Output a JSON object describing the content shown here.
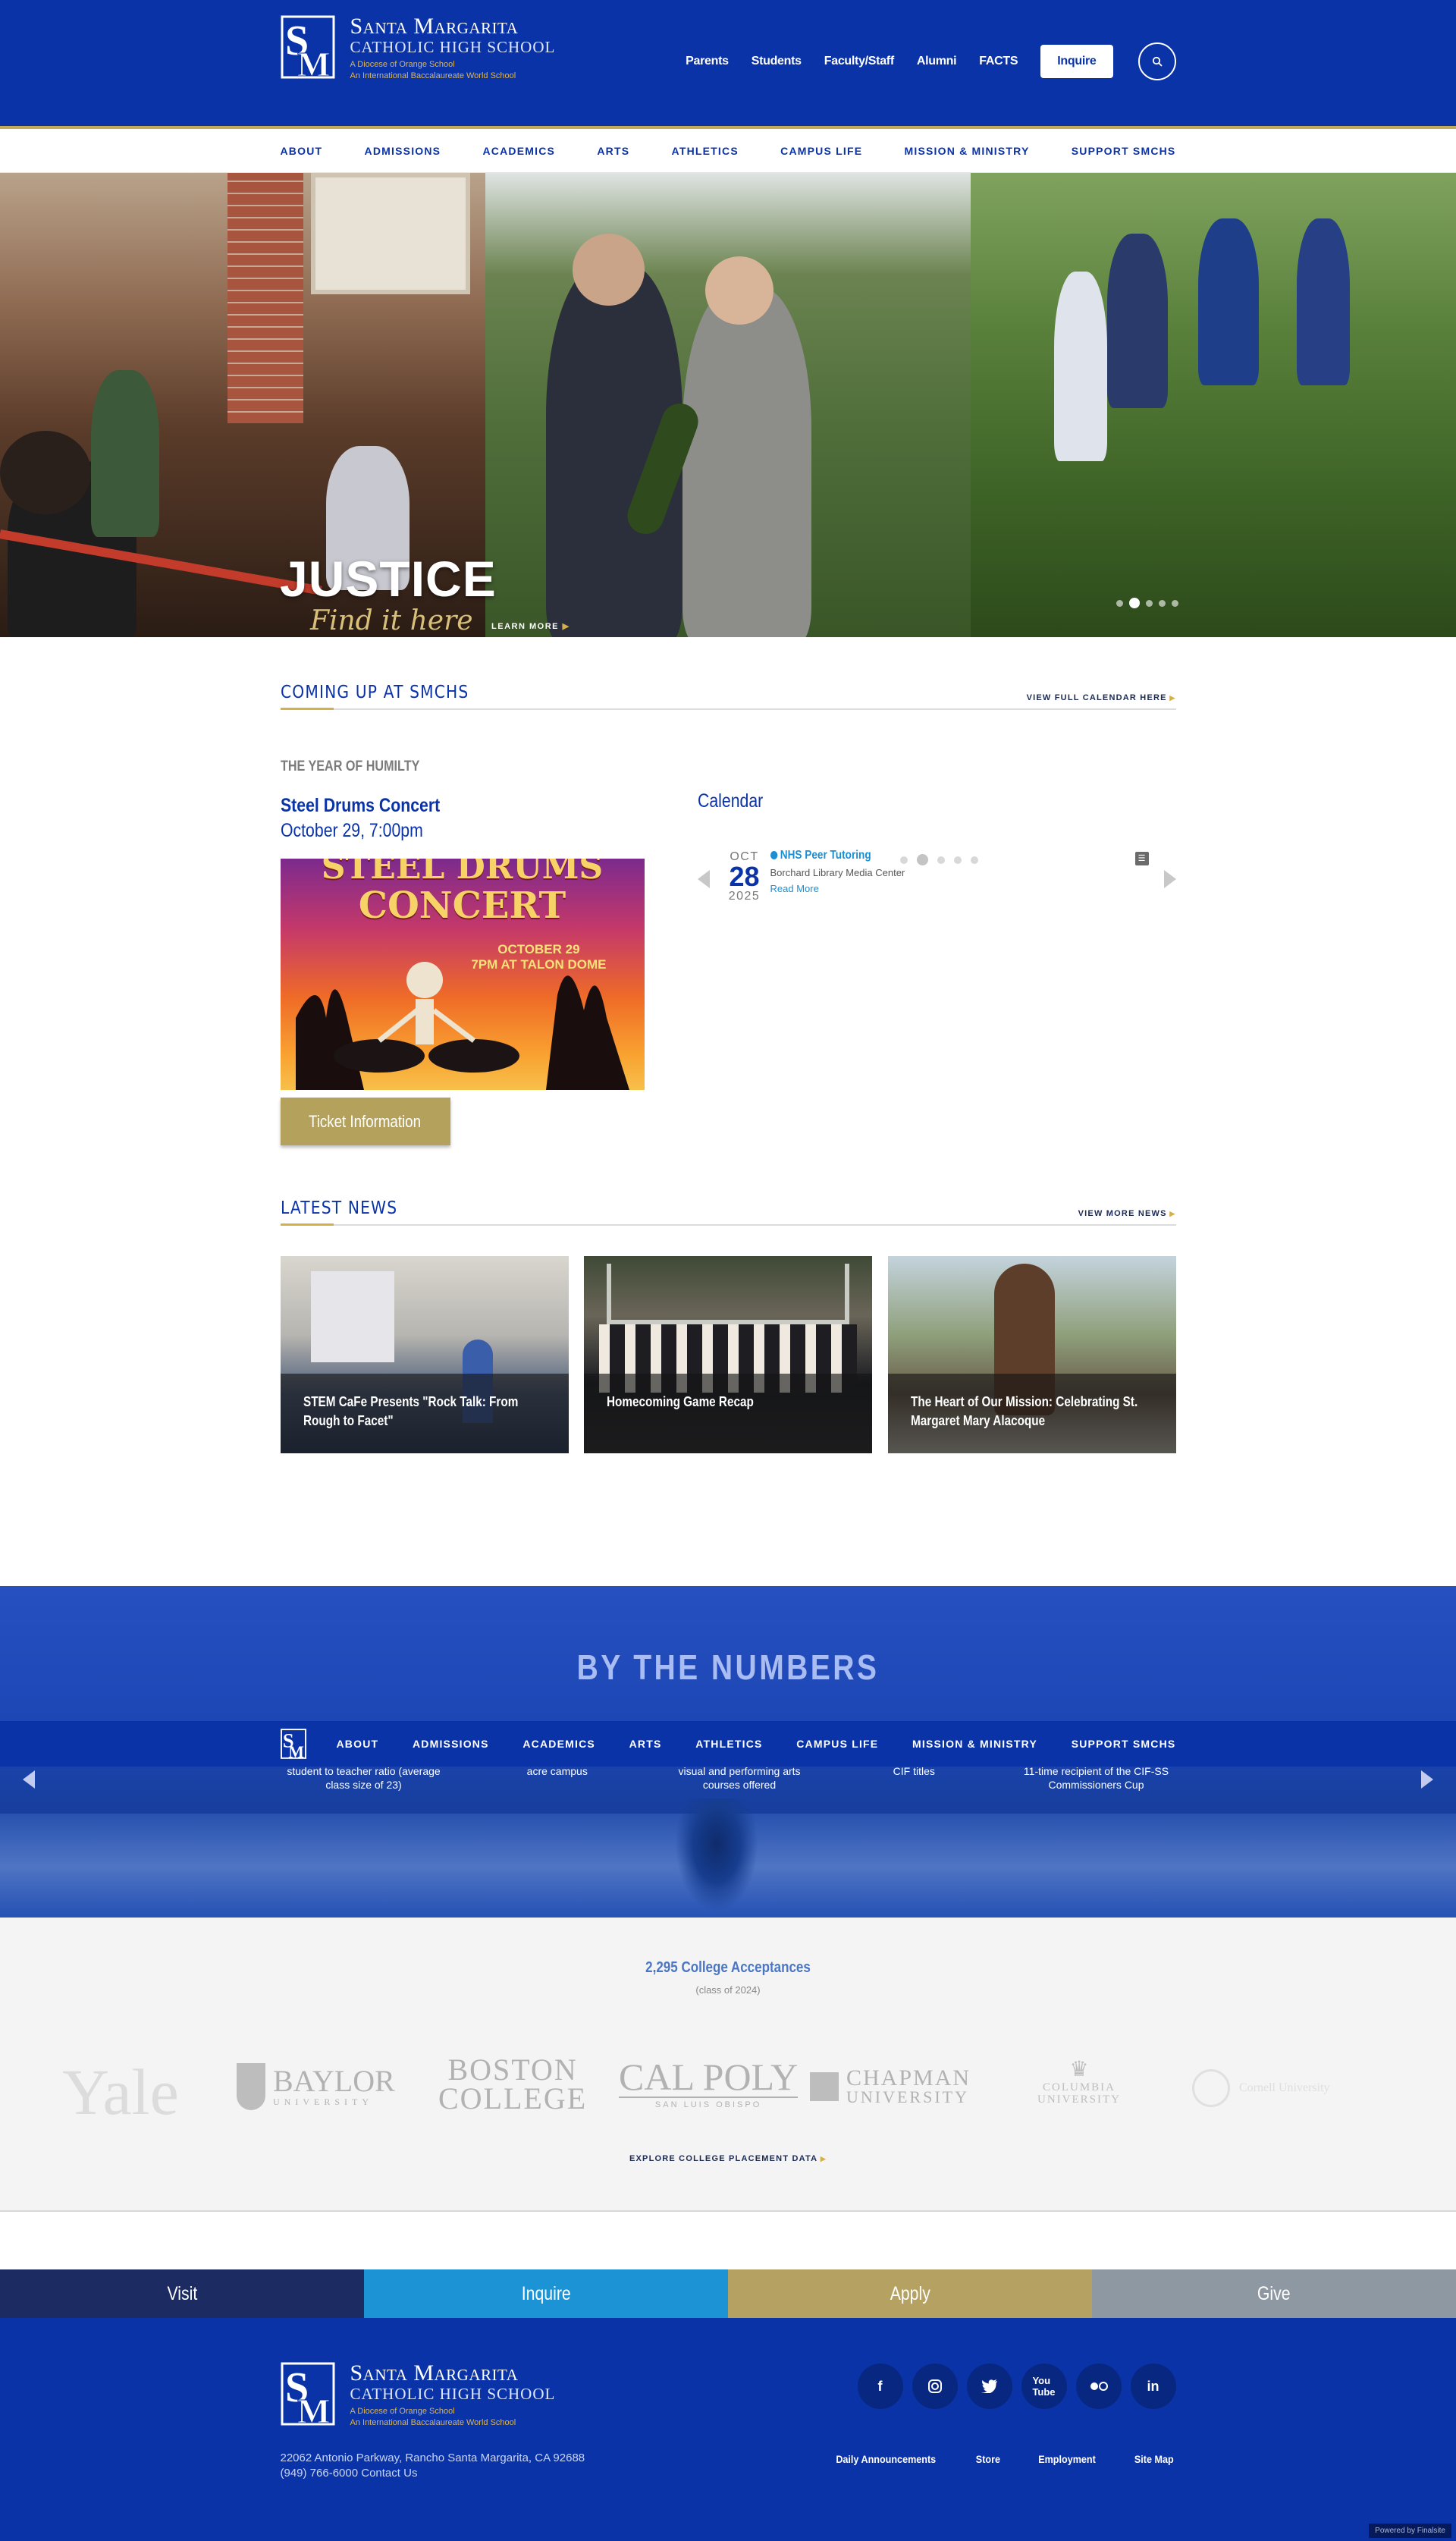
{
  "header": {
    "logo": {
      "name": "Santa Margarita",
      "sub": "Catholic High School",
      "tag1": "A Diocese of Orange School",
      "tag2": "An International Baccalaureate World School"
    },
    "utility": [
      "Parents",
      "Students",
      "Faculty/Staff",
      "Alumni",
      "FACTS"
    ],
    "inquire": "Inquire",
    "search_icon": "search-icon"
  },
  "nav": [
    "ABOUT",
    "ADMISSIONS",
    "ACADEMICS",
    "ARTS",
    "ATHLETICS",
    "CAMPUS LIFE",
    "MISSION & MINISTRY",
    "SUPPORT SMCHS"
  ],
  "hero": {
    "title": "JUSTICE",
    "script": "Find it here",
    "learn_more": "LEARN MORE",
    "active_slide": 2,
    "slide_count": 5
  },
  "coming": {
    "title": "COMING UP AT SMCHS",
    "link": "VIEW FULL CALENDAR HERE",
    "eyebrow": "THE YEAR OF HUMILTY",
    "event_title": "Steel Drums Concert",
    "event_date": "October 29, 7:00pm",
    "poster": {
      "line1": "STEEL DRUMS",
      "line2": "CONCERT",
      "date_line1": "OCTOBER 29",
      "date_line2": "7PM AT TALON DOME"
    },
    "ticket": "Ticket Information",
    "calendar": {
      "title": "Calendar",
      "month": "OCT",
      "day": "28",
      "year": "2025",
      "event": "NHS Peer Tutoring",
      "location": "Borchard Library Media Center",
      "more": "Read More",
      "rss_icon": "rss-icon",
      "active_dot": 2,
      "dot_count": 5
    }
  },
  "news": {
    "title": "LATEST NEWS",
    "link": "VIEW MORE NEWS",
    "items": [
      {
        "caption": "STEM CaFe Presents \"Rock Talk: From Rough to Facet\""
      },
      {
        "caption": "Homecoming Game Recap"
      },
      {
        "caption": "The Heart of Our Mission: Celebrating St. Margaret Mary Alacoque"
      }
    ]
  },
  "numbers": {
    "title": "BY THE NUMBERS",
    "stats": [
      "student to teacher ratio (average class size of 23)",
      "acre campus",
      "visual and performing arts courses offered",
      "CIF titles",
      "11-time recipient of the CIF-SS Commissioners Cup"
    ]
  },
  "college": {
    "title": "2,295 College Acceptances",
    "sub": "(class of 2024)",
    "logos": [
      "Yale",
      "BAYLOR",
      "UNIVERSITY",
      "BOSTON",
      "COLLEGE",
      "CAL POLY",
      "SAN LUIS OBISPO",
      "CHAPMAN",
      "UNIVERSITY",
      "COLUMBIA",
      "UNIVERSITY",
      "Cornell University"
    ],
    "link": "EXPLORE COLLEGE PLACEMENT DATA"
  },
  "cta": [
    {
      "label": "Visit",
      "color": "#1d2b63"
    },
    {
      "label": "Inquire",
      "color": "#1b93d4"
    },
    {
      "label": "Apply",
      "color": "#b5a262"
    },
    {
      "label": "Give",
      "color": "#8e98a3"
    }
  ],
  "footer": {
    "address": "22062 Antonio Parkway, Rancho Santa Margarita, CA 92688",
    "phone": "(949) 766-6000 Contact Us",
    "socials": [
      "facebook-icon",
      "instagram-icon",
      "twitter-icon",
      "youtube-icon",
      "flickr-icon",
      "linkedin-icon"
    ],
    "links": [
      "Daily Announcements",
      "Store",
      "Employment",
      "Site Map"
    ],
    "powered": "Powered by Finalsite"
  },
  "colors": {
    "brand_blue": "#0a33a8",
    "gold": "#d4b049",
    "calendar_blue": "#1c8fd3"
  }
}
